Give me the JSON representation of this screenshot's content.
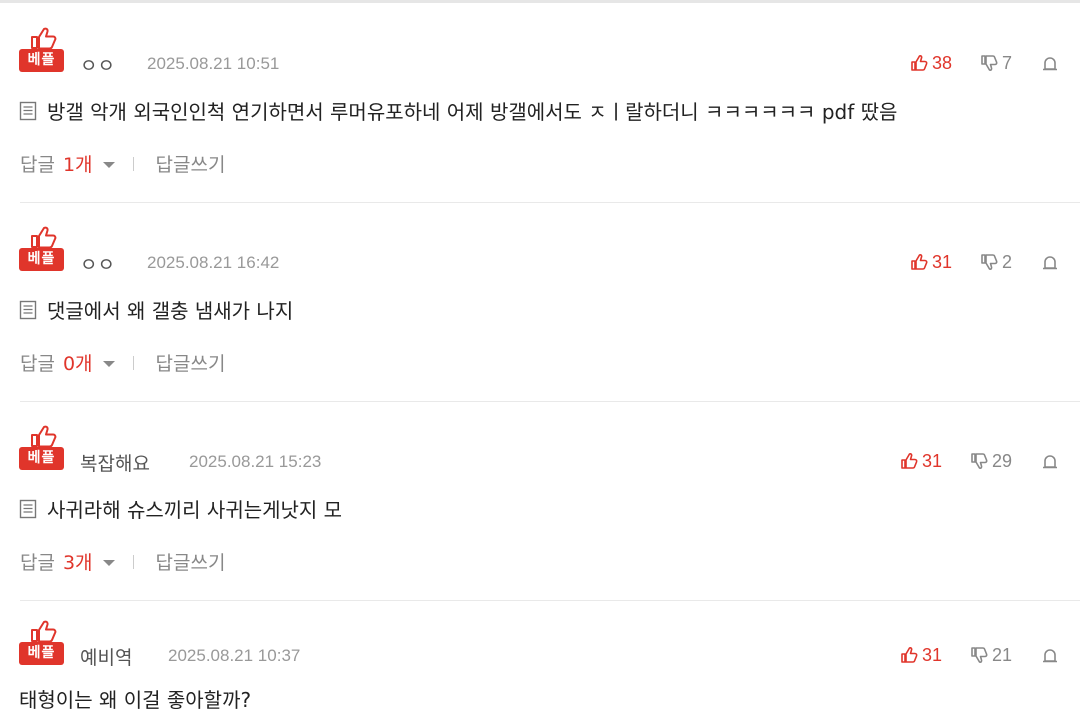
{
  "comments": [
    {
      "badge": "베플",
      "author": "ㅇㅇ",
      "date": "2025.08.21 10:51",
      "upvotes": "38",
      "downvotes": "7",
      "text": "방갤 악개 외국인인척 연기하면서 루머유포하네 어제 방갤에서도 ㅈㅣ랄하더니 ㅋㅋㅋㅋㅋㅋ pdf 땄음",
      "reply_label": "답글",
      "reply_count": "1개",
      "write_reply": "답글쓰기"
    },
    {
      "badge": "베플",
      "author": "ㅇㅇ",
      "date": "2025.08.21 16:42",
      "upvotes": "31",
      "downvotes": "2",
      "text": "댓글에서 왜 갤충 냄새가 나지",
      "reply_label": "답글",
      "reply_count": "0개",
      "write_reply": "답글쓰기"
    },
    {
      "badge": "베플",
      "author": "복잡해요",
      "date": "2025.08.21 15:23",
      "upvotes": "31",
      "downvotes": "29",
      "text": "사귀라해 슈스끼리 사귀는게낫지 모",
      "reply_label": "답글",
      "reply_count": "3개",
      "write_reply": "답글쓰기"
    },
    {
      "badge": "베플",
      "author": "예비역",
      "date": "2025.08.21 10:37",
      "upvotes": "31",
      "downvotes": "21",
      "text": "태형이는 왜 이걸 좋아할까?"
    }
  ],
  "icons": {
    "thumb": "thumbs-up-icon",
    "upvote": "thumbs-up-icon",
    "downvote": "thumbs-down-icon",
    "report": "report-icon",
    "document": "document-icon",
    "caret": "chevron-down-icon"
  },
  "colors": {
    "accent": "#e0352b",
    "muted": "#888888"
  }
}
